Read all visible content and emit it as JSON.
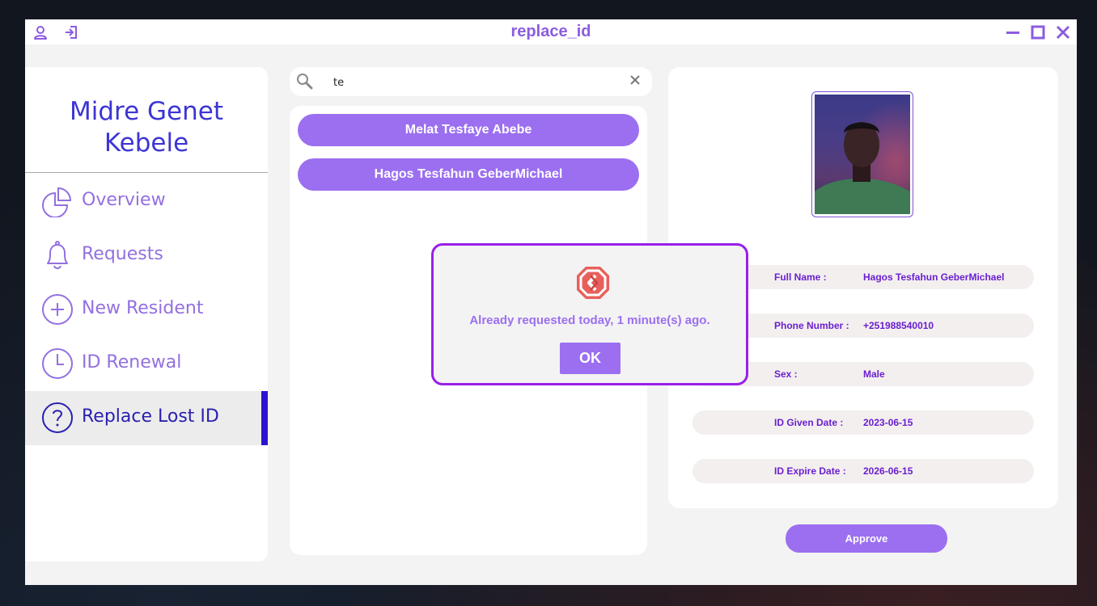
{
  "window": {
    "title": "replace_id"
  },
  "titlebar": {
    "left_icons": [
      "user-icon",
      "logout-icon"
    ],
    "right_icons": [
      "minimize-icon",
      "maximize-icon",
      "close-icon"
    ]
  },
  "sidebar": {
    "kebele_name": "Midre Genet\nKebele",
    "items": [
      {
        "label": "Overview",
        "icon": "pie-chart-icon"
      },
      {
        "label": "Requests",
        "icon": "bell-icon"
      },
      {
        "label": "New Resident",
        "icon": "plus-circle-icon"
      },
      {
        "label": "ID Renewal",
        "icon": "clock-icon"
      },
      {
        "label": "Replace Lost ID",
        "icon": "help-circle-icon",
        "active": true
      }
    ]
  },
  "search": {
    "value": "te",
    "placeholder": ""
  },
  "results": [
    {
      "name": "Melat Tesfaye Abebe"
    },
    {
      "name": "Hagos Tesfahun GeberMichael"
    }
  ],
  "details": {
    "fields": [
      {
        "label": "Full Name :",
        "value": "Hagos Tesfahun GeberMichael"
      },
      {
        "label": "Phone Number :",
        "value": "+251988540010"
      },
      {
        "label": "Sex :",
        "value": "Male"
      },
      {
        "label": "ID Given Date :",
        "value": "2023-06-15"
      },
      {
        "label": "ID Expire Date :",
        "value": "2026-06-15"
      }
    ],
    "approve_label": "Approve"
  },
  "dialog": {
    "message": "Already requested today, 1 minute(s) ago.",
    "ok_label": "OK",
    "icon": "error-icon"
  },
  "colors": {
    "accent": "#9b6ff0",
    "title": "#8b5ce0",
    "kebele": "#3c35d4",
    "active_bar": "#2b14d0",
    "dialog_border": "#9a1fe6",
    "field_text": "#6a1fd0"
  }
}
